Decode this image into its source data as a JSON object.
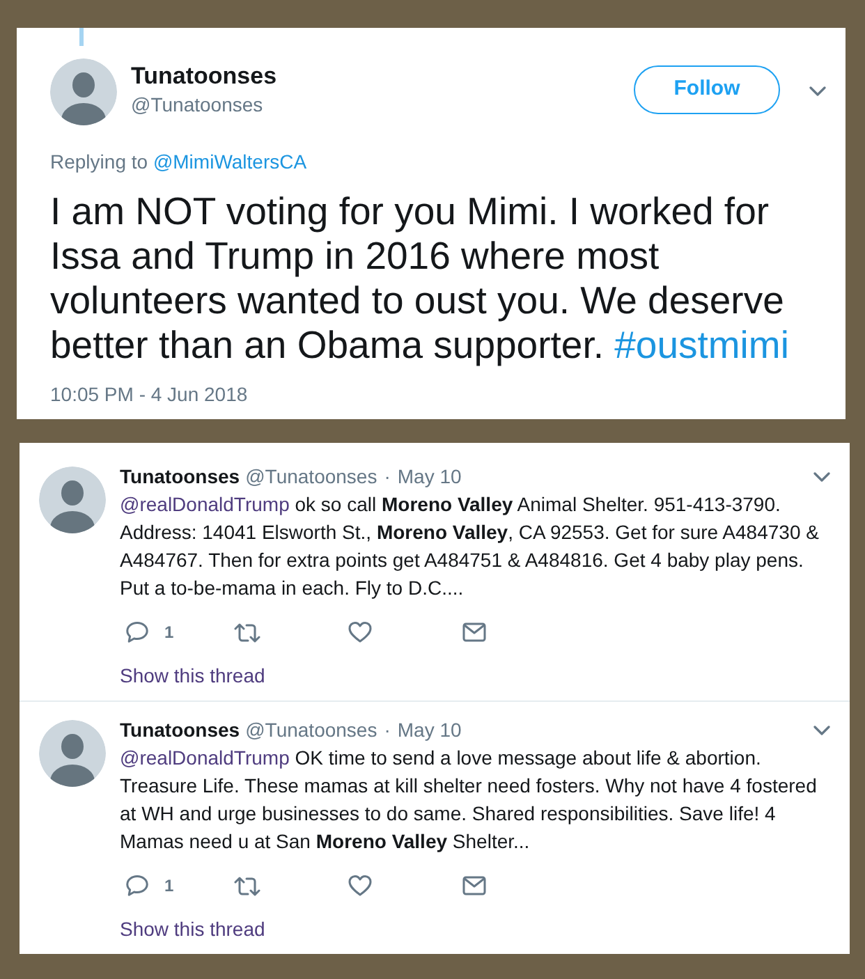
{
  "main_tweet": {
    "display_name": "Tunatoonses",
    "handle": "@Tunatoonses",
    "follow_label": "Follow",
    "replying_to_label": "Replying to",
    "replying_to_handle": "@MimiWaltersCA",
    "text": "I am NOT voting for you Mimi. I worked for Issa and Trump in 2016 where most volunteers wanted to oust you. We deserve better than an Obama supporter.",
    "hashtag": "#oustmimi",
    "timestamp": "10:05 PM - 4 Jun 2018"
  },
  "thread": [
    {
      "display_name": "Tunatoonses",
      "handle": "@Tunatoonses",
      "separator": "·",
      "date": "May 10",
      "mention": "@realDonaldTrump",
      "text": "ok so call **Moreno Valley** Animal Shelter. 951-413-3790. Address: 14041 Elsworth St., **Moreno Valley**, CA 92553. Get for sure A484730 & A484767. Then for extra points get A484751 & A484816. Get 4 baby play pens. Put a to-be-mama in each. Fly to D.C....",
      "reply_count": "1",
      "thread_link": "Show this thread"
    },
    {
      "display_name": "Tunatoonses",
      "handle": "@Tunatoonses",
      "separator": "·",
      "date": "May 10",
      "mention": "@realDonaldTrump",
      "text": "OK time to send a love message about life & abortion. Treasure Life. These mamas at kill shelter need fosters. Why not have 4 fostered at WH and urge businesses to do same. Shared responsibilities. Save life! 4 Mamas need u at San **Moreno Valley** Shelter...",
      "reply_count": "1",
      "thread_link": "Show this thread"
    }
  ]
}
